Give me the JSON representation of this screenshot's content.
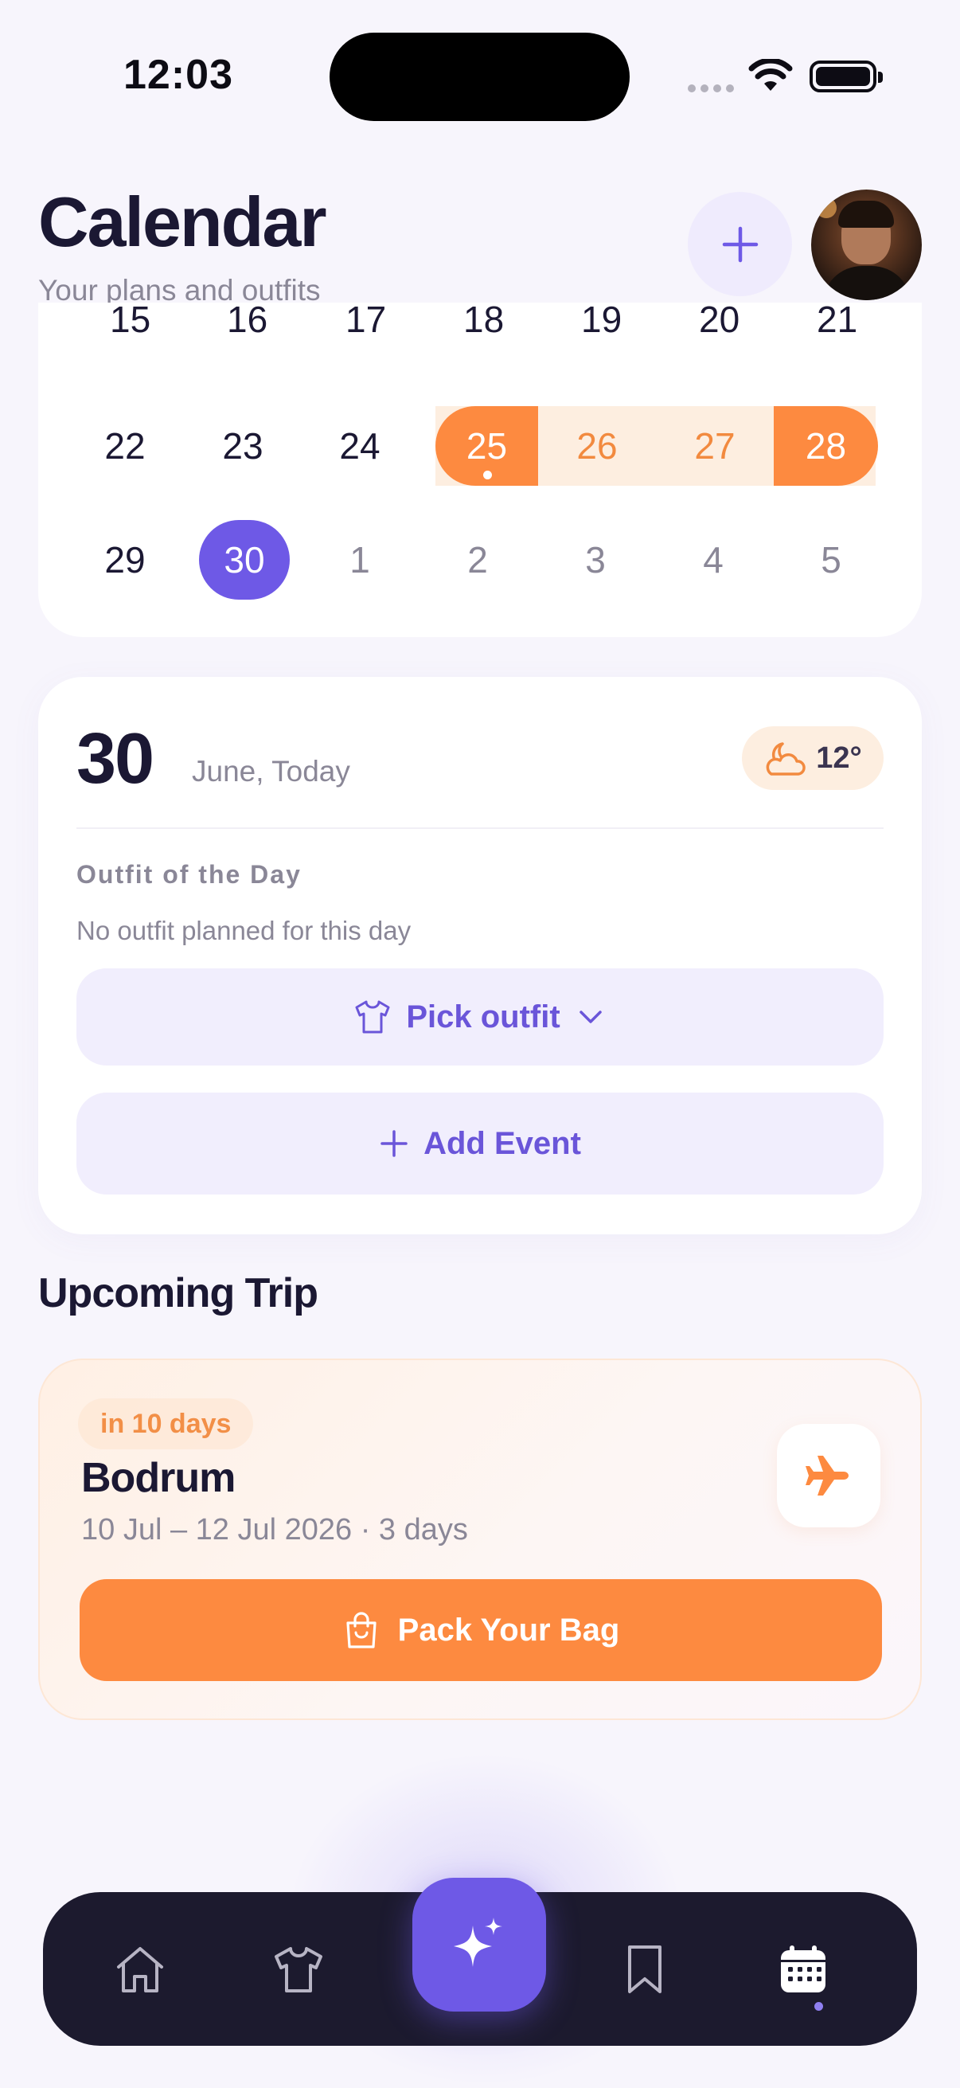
{
  "status_bar": {
    "time": "12:03"
  },
  "header": {
    "title": "Calendar",
    "subtitle": "Your plans and outfits"
  },
  "calendar": {
    "row_partial": [
      "15",
      "16",
      "17",
      "18",
      "19",
      "20",
      "21"
    ],
    "row_week4": [
      "22",
      "23",
      "24",
      "25",
      "26",
      "27",
      "28"
    ],
    "row_week5": [
      "29",
      "30",
      "1",
      "2",
      "3",
      "4",
      "5"
    ],
    "selected_day": "30",
    "trip_range": [
      "25",
      "26",
      "27",
      "28"
    ]
  },
  "day": {
    "number": "30",
    "label": "June, Today",
    "weather_temp": "12°",
    "weather_icon": "cloud-moon-icon",
    "outfit_heading": "Outfit of the Day",
    "outfit_empty": "No outfit planned for this day",
    "pick_outfit_label": "Pick outfit",
    "add_event_label": "Add Event"
  },
  "trip": {
    "section_heading": "Upcoming Trip",
    "badge": "in 10 days",
    "destination": "Bodrum",
    "dates": "10 Jul – 12 Jul 2026 · 3 days",
    "pack_label": "Pack Your Bag"
  },
  "nav": {
    "items": [
      "home-icon",
      "wardrobe-icon",
      "sparkles-icon",
      "bookmark-icon",
      "calendar-icon"
    ],
    "active": "calendar-icon"
  },
  "colors": {
    "accent": "#6e59e6",
    "orange": "#fd8a40",
    "dark": "#1c1a2e"
  }
}
